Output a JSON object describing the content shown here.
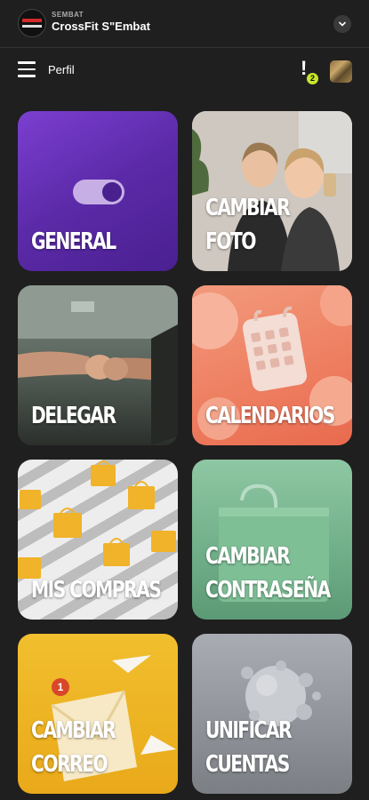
{
  "gym": {
    "subtitle": "SEMBAT",
    "name": "CrossFit S\"Embat",
    "logo_icon": "gym-logo-icon",
    "dropdown_icon": "chevron-down-icon"
  },
  "nav": {
    "title": "Perfil",
    "notification_count": "2",
    "menu_icon": "hamburger-menu-icon",
    "alert_icon": "exclamation-icon",
    "badge_color": "#c8e62c"
  },
  "tiles": [
    {
      "label": "GENERAL"
    },
    {
      "label": "CAMBIAR\nFOTO"
    },
    {
      "label": "DELEGAR"
    },
    {
      "label": "CALENDARIOS"
    },
    {
      "label": "MIS COMPRAS"
    },
    {
      "label": "CAMBIAR\nCONTRASEÑA"
    },
    {
      "label": "CAMBIAR\nCORREO"
    },
    {
      "label": "UNIFICAR\nCUENTAS"
    }
  ],
  "colors": {
    "background": "#1f1f1f",
    "general_tile": "#6a33c0",
    "calendar_tile": "#ef8264",
    "password_tile": "#7ab893",
    "mail_tile": "#eeb526",
    "mail_badge": "#d9472b"
  }
}
